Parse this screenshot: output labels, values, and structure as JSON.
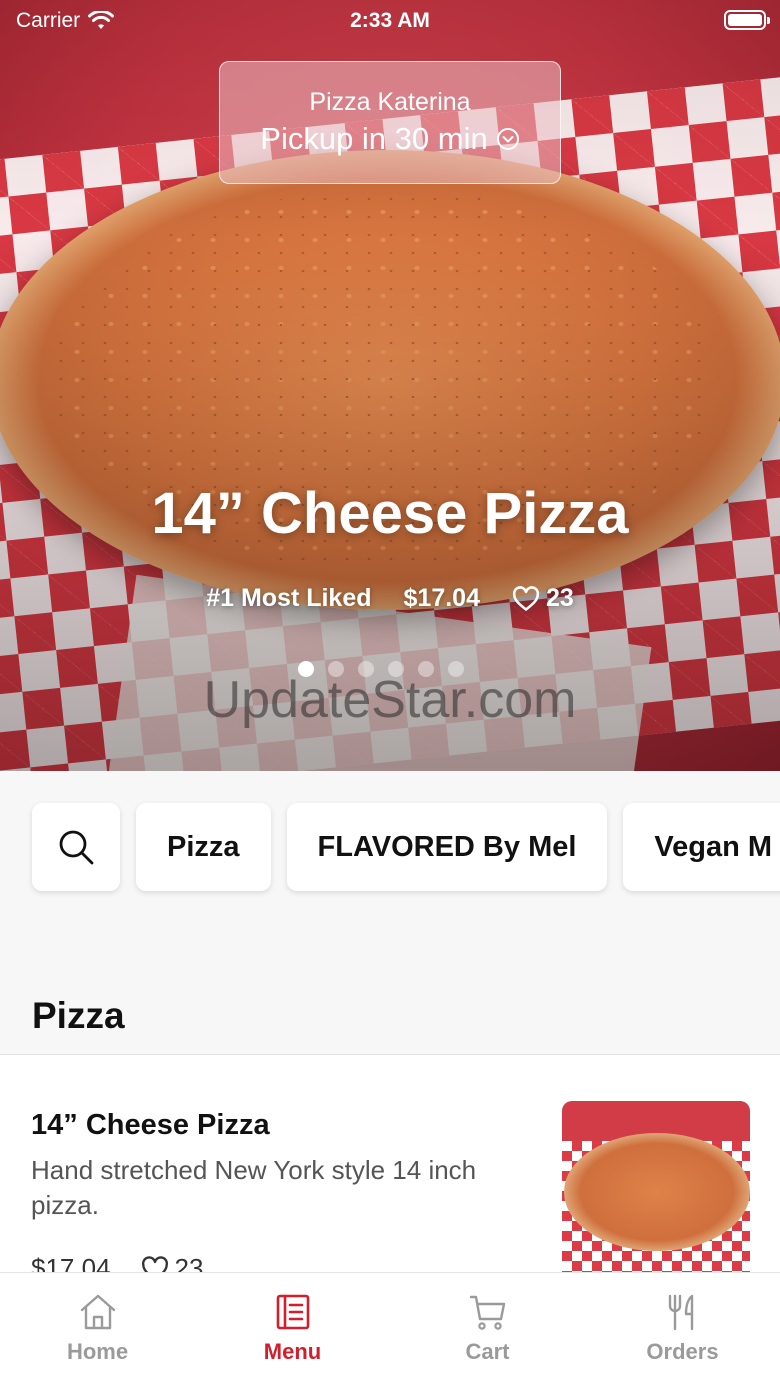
{
  "status_bar": {
    "carrier": "Carrier",
    "time": "2:33 AM"
  },
  "store": {
    "name": "Pizza Katerina",
    "pickup_label": "Pickup in 30 min"
  },
  "hero": {
    "title": "14” Cheese Pizza",
    "badge": "#1 Most Liked",
    "price": "$17.04",
    "likes": "23",
    "carousel": {
      "count": 6,
      "active": 1
    }
  },
  "watermark": "UpdateStar.com",
  "categories": [
    {
      "label": "Pizza"
    },
    {
      "label": "FLAVORED By Mel"
    },
    {
      "label": "Vegan M"
    }
  ],
  "section": {
    "title": "Pizza"
  },
  "items": [
    {
      "name": "14” Cheese Pizza",
      "description": "Hand stretched New York style 14 inch pizza.",
      "price": "$17.04",
      "likes": "23"
    }
  ],
  "tabs": [
    {
      "label": "Home",
      "icon": "home-icon",
      "active": false
    },
    {
      "label": "Menu",
      "icon": "menu-icon",
      "active": true
    },
    {
      "label": "Cart",
      "icon": "cart-icon",
      "active": false
    },
    {
      "label": "Orders",
      "icon": "utensils-icon",
      "active": false
    }
  ],
  "colors": {
    "accent": "#d21f2b",
    "inactive_tab": "#9a9a9a"
  }
}
